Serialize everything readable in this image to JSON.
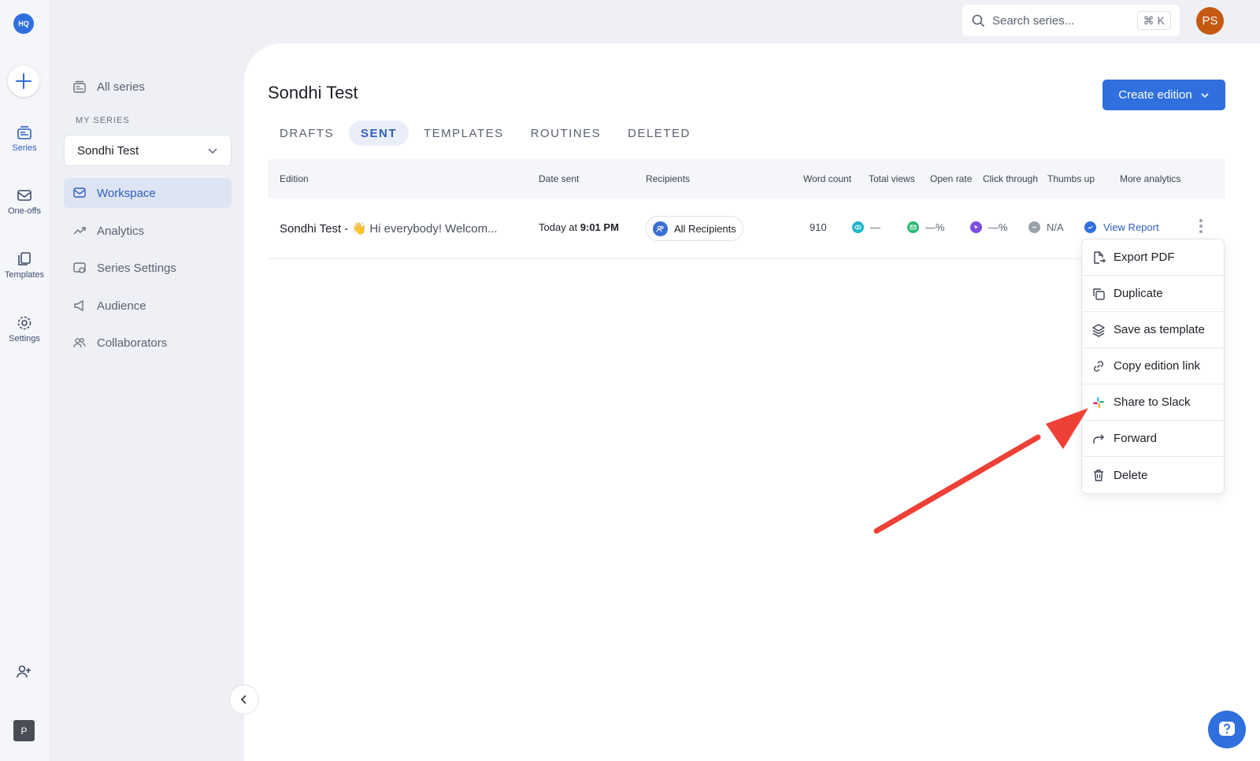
{
  "rail": {
    "logo": "HQ",
    "items": [
      {
        "label": "Series",
        "icon": "series-icon"
      },
      {
        "label": "One-offs",
        "icon": "one-offs-icon"
      },
      {
        "label": "Templates",
        "icon": "templates-icon"
      },
      {
        "label": "Settings",
        "icon": "settings-icon"
      }
    ],
    "user_initial": "P"
  },
  "sidebar": {
    "all_series": "All series",
    "my_series_label": "MY SERIES",
    "selected_series": "Sondhi Test",
    "items": [
      {
        "label": "Workspace"
      },
      {
        "label": "Analytics"
      },
      {
        "label": "Series Settings"
      },
      {
        "label": "Audience"
      },
      {
        "label": "Collaborators"
      }
    ]
  },
  "header": {
    "search_placeholder": "Search series...",
    "shortcut_key": "K",
    "user_initials": "PS"
  },
  "main": {
    "title": "Sondhi Test",
    "create_button": "Create edition",
    "tabs": [
      {
        "label": "DRAFTS"
      },
      {
        "label": "SENT"
      },
      {
        "label": "TEMPLATES"
      },
      {
        "label": "ROUTINES"
      },
      {
        "label": "DELETED"
      }
    ],
    "active_tab": "SENT"
  },
  "table": {
    "columns": [
      "Edition",
      "Date sent",
      "Recipients",
      "Word count",
      "Total views",
      "Open rate",
      "Click through",
      "Thumbs up",
      "More analytics"
    ],
    "rows": [
      {
        "edition_name": "Sondhi Test - ",
        "edition_emoji": "👋",
        "edition_preview": "Hi everybody! Welcom...",
        "date_prefix": "Today at ",
        "date_time": "9:01 PM",
        "recipients": "All Recipients",
        "word_count": "910",
        "total_views": "—",
        "open_rate": "—%",
        "click_through": "—%",
        "thumbs_up": "N/A",
        "more_analytics": "View Report"
      }
    ]
  },
  "menu": {
    "items": [
      {
        "label": "Export PDF"
      },
      {
        "label": "Duplicate"
      },
      {
        "label": "Save as template"
      },
      {
        "label": "Copy edition link"
      },
      {
        "label": "Share to Slack"
      },
      {
        "label": "Forward"
      },
      {
        "label": "Delete"
      }
    ]
  },
  "colors": {
    "accent": "#2f6fde",
    "annotation_arrow": "#ee4036",
    "views_icon": "#1fb5c9",
    "open_icon": "#2eb872",
    "click_icon": "#7a4fe0"
  }
}
